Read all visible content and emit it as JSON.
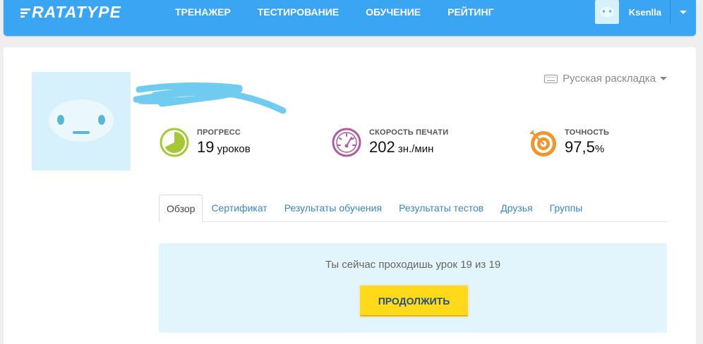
{
  "header": {
    "logo": "RATATYPE",
    "nav": [
      {
        "label": "ТРЕНАЖЕР"
      },
      {
        "label": "ТЕСТИРОВАНИЕ"
      },
      {
        "label": "ОБУЧЕНИЕ"
      },
      {
        "label": "РЕЙТИНГ"
      }
    ],
    "user": {
      "name": "Ksenlla"
    }
  },
  "profile": {
    "keyboard_layout": "Русская раскладка",
    "stats": [
      {
        "label": "ПРОГРЕСС",
        "value": "19",
        "unit": " уроков",
        "color": "#a6c837"
      },
      {
        "label": "СКОРОСТЬ ПЕЧАТИ",
        "value": "202",
        "unit": " зн./мин",
        "color": "#b05aa5"
      },
      {
        "label": "ТОЧНОСТЬ",
        "value": "97,5",
        "unit": "%",
        "color": "#f0952d"
      }
    ],
    "tabs": [
      {
        "label": "Обзор",
        "active": true
      },
      {
        "label": "Сертификат"
      },
      {
        "label": "Результаты обучения"
      },
      {
        "label": "Результаты тестов"
      },
      {
        "label": "Друзья"
      },
      {
        "label": "Группы"
      }
    ],
    "overview": {
      "message": "Ты сейчас проходишь урок 19 из 19",
      "continue_label": "ПРОДОЛЖИТЬ"
    }
  },
  "colors": {
    "brand": "#3aa5f2",
    "button": "#ffd91a",
    "link": "#3a87c7",
    "panel": "#e2f4fc"
  }
}
